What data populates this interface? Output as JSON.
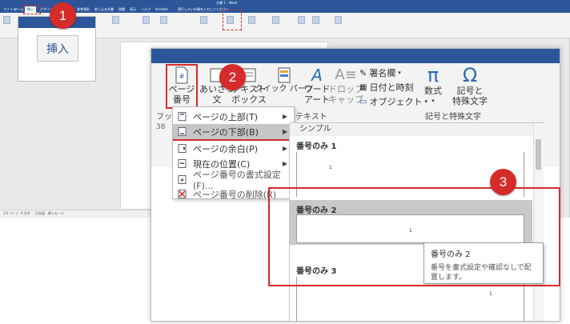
{
  "background_window": {
    "title": "文書 1 - Word",
    "tabs": [
      "ファイル",
      "ホーム",
      "挿入",
      "デザイン",
      "レイアウト",
      "参考資料",
      "差し込み文書",
      "校閲",
      "表示",
      "ヘルプ",
      "Acrobat",
      "実行したい作業を入力してください"
    ],
    "active_tab": "挿入",
    "status": [
      "1/1 ページ",
      "0 文字",
      "日本語",
      "挿入モード"
    ]
  },
  "callout": {
    "tab_label": "挿入"
  },
  "badges": [
    "1",
    "2",
    "3"
  ],
  "ribbon": {
    "page_number_button": "ページ\n番号",
    "greeting_button": "あいさつ\n文",
    "textbox_button": "テキスト\nボックス",
    "quickparts_button": "クイック パーツ",
    "wordart_button": "ワード\nアート",
    "dropcap_button": "ドロップ\nキャップ",
    "signature_line": "署名欄",
    "date_time": "日付と時刻",
    "object": "オブジェクト",
    "equation_button": "数式",
    "symbol_button": "記号と\n特殊文字",
    "groups": {
      "hf": "フッ",
      "text": "テキスト",
      "symbols": "記号と特殊文字"
    }
  },
  "menu": {
    "items": [
      {
        "label": "ページの上部(T)",
        "has_arrow": true
      },
      {
        "label": "ページの下部(B)",
        "has_arrow": true
      },
      {
        "label": "ページの余白(P)",
        "has_arrow": true
      },
      {
        "label": "現在の位置(C)",
        "has_arrow": true
      },
      {
        "label": "ページ番号の書式設定(F)...",
        "has_arrow": false
      },
      {
        "label": "ページ番号の削除(R)",
        "has_arrow": false
      }
    ],
    "highlighted_index": 1
  },
  "gallery": {
    "header": "シンプル",
    "items": [
      "番号のみ 1",
      "番号のみ 2",
      "番号のみ 3"
    ],
    "page_number": "1",
    "selected_index": 1,
    "prefix": "38"
  },
  "tooltip": {
    "title": "番号のみ 2",
    "description": "番号を書式設定や確認なしで配置します。"
  },
  "colors": {
    "accent": "#2b579a",
    "highlight_red": "#d52b2b",
    "ribbon_bg": "#f3f3f3"
  }
}
